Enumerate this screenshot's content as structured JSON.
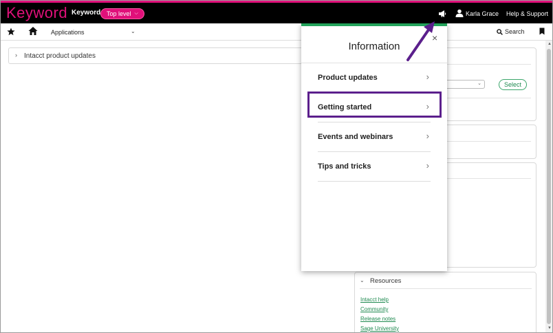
{
  "header": {
    "logo_text": "Keyword",
    "company": "Keyword",
    "level_pill": "Top level",
    "user_name": "Karla Grace",
    "help_label": "Help & Support",
    "brand_color": "#e0107a"
  },
  "nav": {
    "applications_label": "Applications",
    "search_label": "Search"
  },
  "main": {
    "collapsed_panel_label": "Intacct product updates",
    "select_button": "Select",
    "resources_title": "Resources",
    "resources_links": [
      "Intacct help",
      "Community",
      "Release notes",
      "Sage University"
    ]
  },
  "popup": {
    "title": "Information",
    "close": "×",
    "items": [
      {
        "label": "Product updates"
      },
      {
        "label": "Getting started"
      },
      {
        "label": "Events and webinars"
      },
      {
        "label": "Tips and tricks"
      }
    ],
    "accent": "#22a25a",
    "highlight_color": "#5b1f8c"
  }
}
